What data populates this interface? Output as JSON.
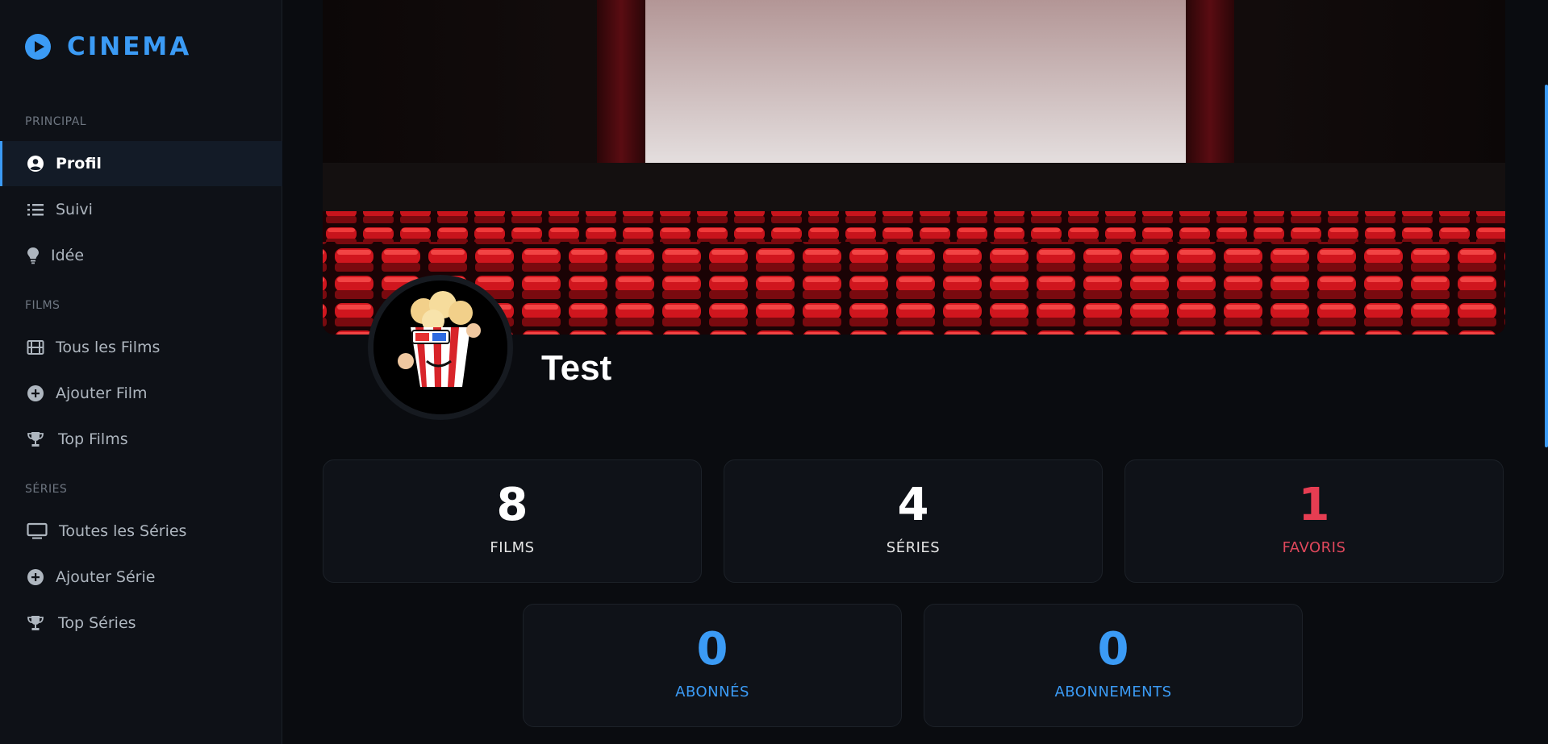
{
  "app": {
    "title": "CINEMA",
    "accent_color": "#3b9bf5"
  },
  "sidebar": {
    "sections": [
      {
        "label": "PRINCIPAL"
      },
      {
        "label": "FILMS"
      },
      {
        "label": "SÉRIES"
      }
    ],
    "items": [
      {
        "label": "Profil",
        "icon": "user-circle-icon",
        "active": true
      },
      {
        "label": "Suivi",
        "icon": "list-icon"
      },
      {
        "label": "Idée",
        "icon": "lightbulb-icon"
      },
      {
        "label": "Tous les Films",
        "icon": "film-icon"
      },
      {
        "label": "Ajouter Film",
        "icon": "plus-circle-icon"
      },
      {
        "label": "Top Films",
        "icon": "trophy-icon"
      },
      {
        "label": "Toutes les Séries",
        "icon": "tv-icon"
      },
      {
        "label": "Ajouter Série",
        "icon": "plus-circle-icon"
      },
      {
        "label": "Top Séries",
        "icon": "trophy-icon"
      }
    ]
  },
  "profile": {
    "username": "Test"
  },
  "stats": [
    {
      "value": "8",
      "label": "FILMS",
      "color": "#ffffff"
    },
    {
      "value": "4",
      "label": "SÉRIES",
      "color": "#ffffff"
    },
    {
      "value": "1",
      "label": "FAVORIS",
      "color": "#e63d52"
    },
    {
      "value": "0",
      "label": "ABONNÉS",
      "color": "#3b9bf5"
    },
    {
      "value": "0",
      "label": "ABONNEMENTS",
      "color": "#3b9bf5"
    }
  ]
}
